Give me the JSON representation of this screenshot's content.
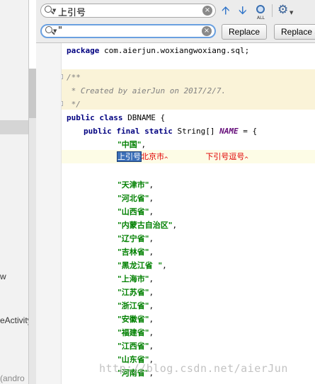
{
  "left_panel": {
    "fragments": [
      "w",
      "eActivity",
      "(andro"
    ]
  },
  "find_bar": {
    "search_value": "上引号",
    "replace_value": "\"",
    "replace_label": "Replace",
    "replace_all_label": "Replace all",
    "all_occurrences_label": "ALL"
  },
  "editor": {
    "package_kw": "package",
    "package_name": "com.aierjun.woxiangwoxiang.sql;",
    "doc_open": "/**",
    "doc_body": " * Created by aierJun on 2017/2/7.",
    "doc_close": " */",
    "class_kw": "public class",
    "class_name": "DBNAME {",
    "field_kw": "public final static",
    "field_type": "String[]",
    "field_name": "NAME",
    "field_assign": " = {",
    "first_item": "\"中国\"",
    "first_comma": ",",
    "match_text": "上引号",
    "err_a": "北京市",
    "err_b": "下引号逗号",
    "items": [
      "\"天津市\"",
      "\"河北省\"",
      "\"山西省\"",
      "\"内蒙古自治区\"",
      "\"辽宁省\"",
      "\"吉林省\"",
      "\"黑龙江省  \"",
      "\"上海市\"",
      "\"江苏省\"",
      "\"浙江省\"",
      "\"安徽省\"",
      "\"福建省\"",
      "\"江西省\"",
      "\"山东省\"",
      "\"河南省\""
    ],
    "item_sep": ","
  },
  "watermark": "http://blog.csdn.net/aierJun",
  "colors": {
    "keyword": "#000080",
    "string": "#008000",
    "comment": "#808080",
    "constant": "#660e7a",
    "error": "#e00000",
    "match": "#3b6fb8"
  }
}
